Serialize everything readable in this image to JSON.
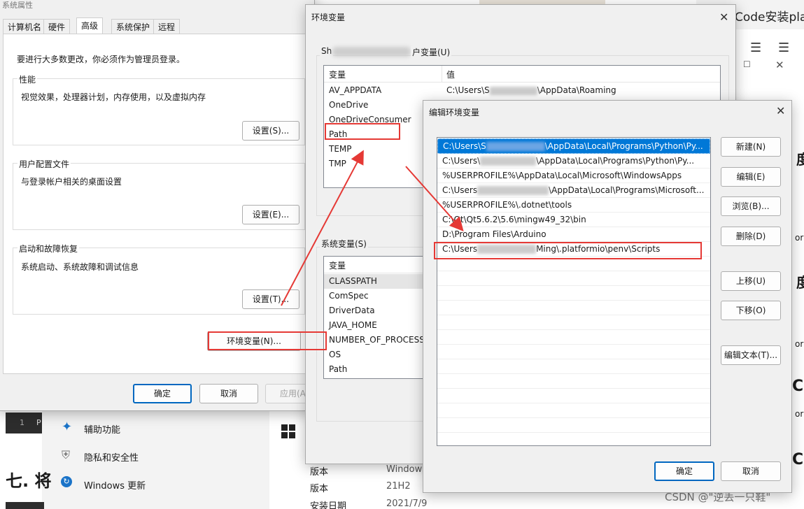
{
  "bg": {
    "right_title": "Code安装platfo",
    "settings_items": [
      "辅助功能",
      "隐私和安全性",
      "Windows 更新"
    ],
    "article_heading": "七. 将",
    "article_num": "1",
    "article_p": "P",
    "info_rows": [
      {
        "label": "版本",
        "value": "Windows"
      },
      {
        "label": "版本",
        "value": "21H2"
      },
      {
        "label": "安装日期",
        "value": "2021/7/9"
      }
    ],
    "side_chars": [
      "度",
      "or",
      "度",
      "or",
      "C",
      "or",
      "C"
    ],
    "watermark": "CSDN @\"逆丢一只鞋\""
  },
  "sysprops": {
    "title": "系统属性",
    "tabs": [
      "计算机名",
      "硬件",
      "高级",
      "系统保护",
      "远程"
    ],
    "admin_note": "要进行大多数更改，你必须作为管理员登录。",
    "perf_title": "性能",
    "perf_desc": "视觉效果，处理器计划，内存使用，以及虚拟内存",
    "perf_btn": "设置(S)...",
    "profile_title": "用户配置文件",
    "profile_desc": "与登录帐户相关的桌面设置",
    "profile_btn": "设置(E)...",
    "startup_title": "启动和故障恢复",
    "startup_desc": "系统启动、系统故障和调试信息",
    "startup_btn": "设置(T)...",
    "env_btn": "环境变量(N)...",
    "ok": "确定",
    "cancel": "取消",
    "apply": "应用(A"
  },
  "envvars": {
    "title": "环境变量",
    "user_group_prefix": "Sh",
    "user_group_suffix": "户变量(U)",
    "col_var": "变量",
    "col_val": "值",
    "user_vars": [
      {
        "name": "AV_APPDATA",
        "value": "C:\\Users\\S",
        "value2": "\\AppData\\Roaming"
      },
      {
        "name": "OneDrive",
        "value": "",
        "value2": ""
      },
      {
        "name": "OneDriveConsumer",
        "value": "",
        "value2": ""
      },
      {
        "name": "Path",
        "value": "",
        "value2": ""
      },
      {
        "name": "TEMP",
        "value": "",
        "value2": ""
      },
      {
        "name": "TMP",
        "value": "",
        "value2": ""
      }
    ],
    "sys_group": "系统变量(S)",
    "sys_vars": [
      "CLASSPATH",
      "ComSpec",
      "DriverData",
      "JAVA_HOME",
      "NUMBER_OF_PROCESSO",
      "OS",
      "Path"
    ]
  },
  "editenv": {
    "title": "编辑环境变量",
    "paths": [
      {
        "a": "C:\\Users\\S",
        "b": "\\AppData\\Local\\Programs\\Python\\Py..."
      },
      {
        "a": "C:\\Users\\",
        "b": "\\AppData\\Local\\Programs\\Python\\Py..."
      },
      {
        "a": "%USERPROFILE%\\AppData\\Local\\Microsoft\\WindowsApps",
        "b": ""
      },
      {
        "a": "C:\\Users",
        "b": "\\AppData\\Local\\Programs\\Microsoft..."
      },
      {
        "a": "%USERPROFILE%\\.dotnet\\tools",
        "b": ""
      },
      {
        "a": "C:\\Qt\\Qt5.6.2\\5.6\\mingw49_32\\bin",
        "b": ""
      },
      {
        "a": "D:\\Program Files\\Arduino",
        "b": ""
      },
      {
        "a": "C:\\Users",
        "b": "Ming\\.platformio\\penv\\Scripts"
      }
    ],
    "btn_new": "新建(N)",
    "btn_edit": "编辑(E)",
    "btn_browse": "浏览(B)...",
    "btn_delete": "删除(D)",
    "btn_up": "上移(U)",
    "btn_down": "下移(O)",
    "btn_edittext": "编辑文本(T)...",
    "ok": "确定",
    "cancel": "取消"
  },
  "colors": {
    "selection": "#0078d7",
    "annotation": "#e53935",
    "primary": "#0067c0"
  }
}
